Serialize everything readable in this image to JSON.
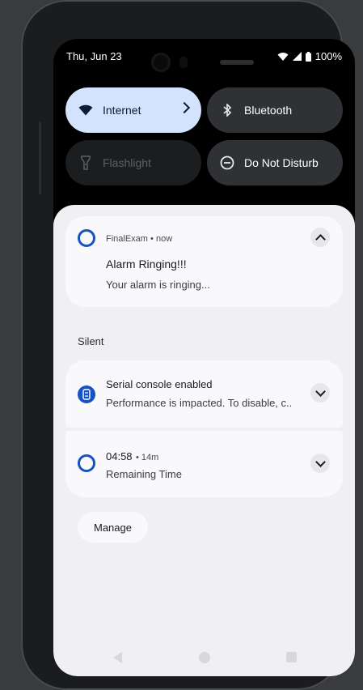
{
  "status_bar": {
    "date": "Thu, Jun 23",
    "battery": "100%"
  },
  "quick_settings": {
    "internet": "Internet",
    "bluetooth": "Bluetooth",
    "flashlight": "Flashlight",
    "dnd": "Do Not Disturb"
  },
  "notifications": {
    "alarm": {
      "app": "FinalExam",
      "time": "now",
      "title": "Alarm Ringing!!!",
      "text": "Your alarm is ringing..."
    },
    "section_label": "Silent",
    "serial": {
      "title": "Serial console enabled",
      "text": "Performance is impacted. To disable, c.."
    },
    "timer": {
      "title": "04:58",
      "time": "14m",
      "text": "Remaining Time"
    }
  },
  "manage_label": "Manage",
  "colors": {
    "accent": "#1552c4",
    "internet_tile": "#d3e3fd",
    "power_button": "#e06f55"
  }
}
